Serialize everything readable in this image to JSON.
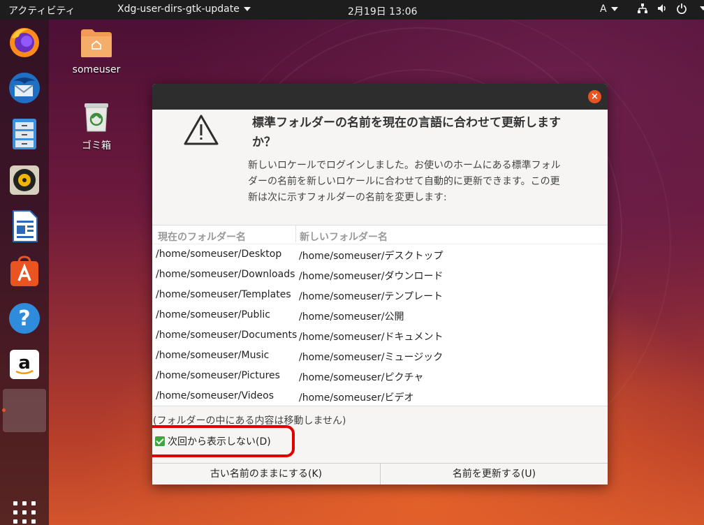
{
  "topbar": {
    "activities": "アクティビティ",
    "app_menu": "Xdg-user-dirs-gtk-update",
    "clock": "2月19日 13:06",
    "input_method": "A"
  },
  "desktop": {
    "icons": [
      {
        "label": "someuser",
        "icon": "home-folder-icon"
      },
      {
        "label": "ゴミ箱",
        "icon": "trash-icon"
      }
    ]
  },
  "dock": {
    "items": [
      "firefox-icon",
      "thunderbird-icon",
      "files-icon",
      "rhythmbox-icon",
      "writer-icon",
      "software-icon",
      "help-icon",
      "amazon-icon",
      "active-window-icon"
    ]
  },
  "dialog": {
    "headline_line1": "標準フォルダーの名前を現在の言語に合わせて更新します",
    "headline_line2": "か？",
    "description_line1": "新しいロケールでログインしました。お使いのホームにある標準フォル",
    "description_line2": "ダーの名前を新しいロケールに合わせて自動的に更新できます。この更",
    "description_line3": "新は次に示すフォルダーの名前を変更します:",
    "columns": [
      "現在のフォルダー名",
      "新しいフォルダー名"
    ],
    "rows": [
      [
        "/home/someuser/Desktop",
        "/home/someuser/デスクトップ"
      ],
      [
        "/home/someuser/Downloads",
        "/home/someuser/ダウンロード"
      ],
      [
        "/home/someuser/Templates",
        "/home/someuser/テンプレート"
      ],
      [
        "/home/someuser/Public",
        "/home/someuser/公開"
      ],
      [
        "/home/someuser/Documents",
        "/home/someuser/ドキュメント"
      ],
      [
        "/home/someuser/Music",
        "/home/someuser/ミュージック"
      ],
      [
        "/home/someuser/Pictures",
        "/home/someuser/ピクチャ"
      ],
      [
        "/home/someuser/Videos",
        "/home/someuser/ビデオ"
      ]
    ],
    "note": "(フォルダーの中にある内容は移動しません)",
    "checkbox_label": "次回から表示しない(D)",
    "checkbox_checked": true,
    "keep_button": "古い名前のままにする(K)",
    "update_button": "名前を更新する(U)",
    "close_symbol": "×"
  },
  "colors": {
    "accent": "#e95420",
    "highlight": "#e00000",
    "check": "#3fa63f"
  }
}
